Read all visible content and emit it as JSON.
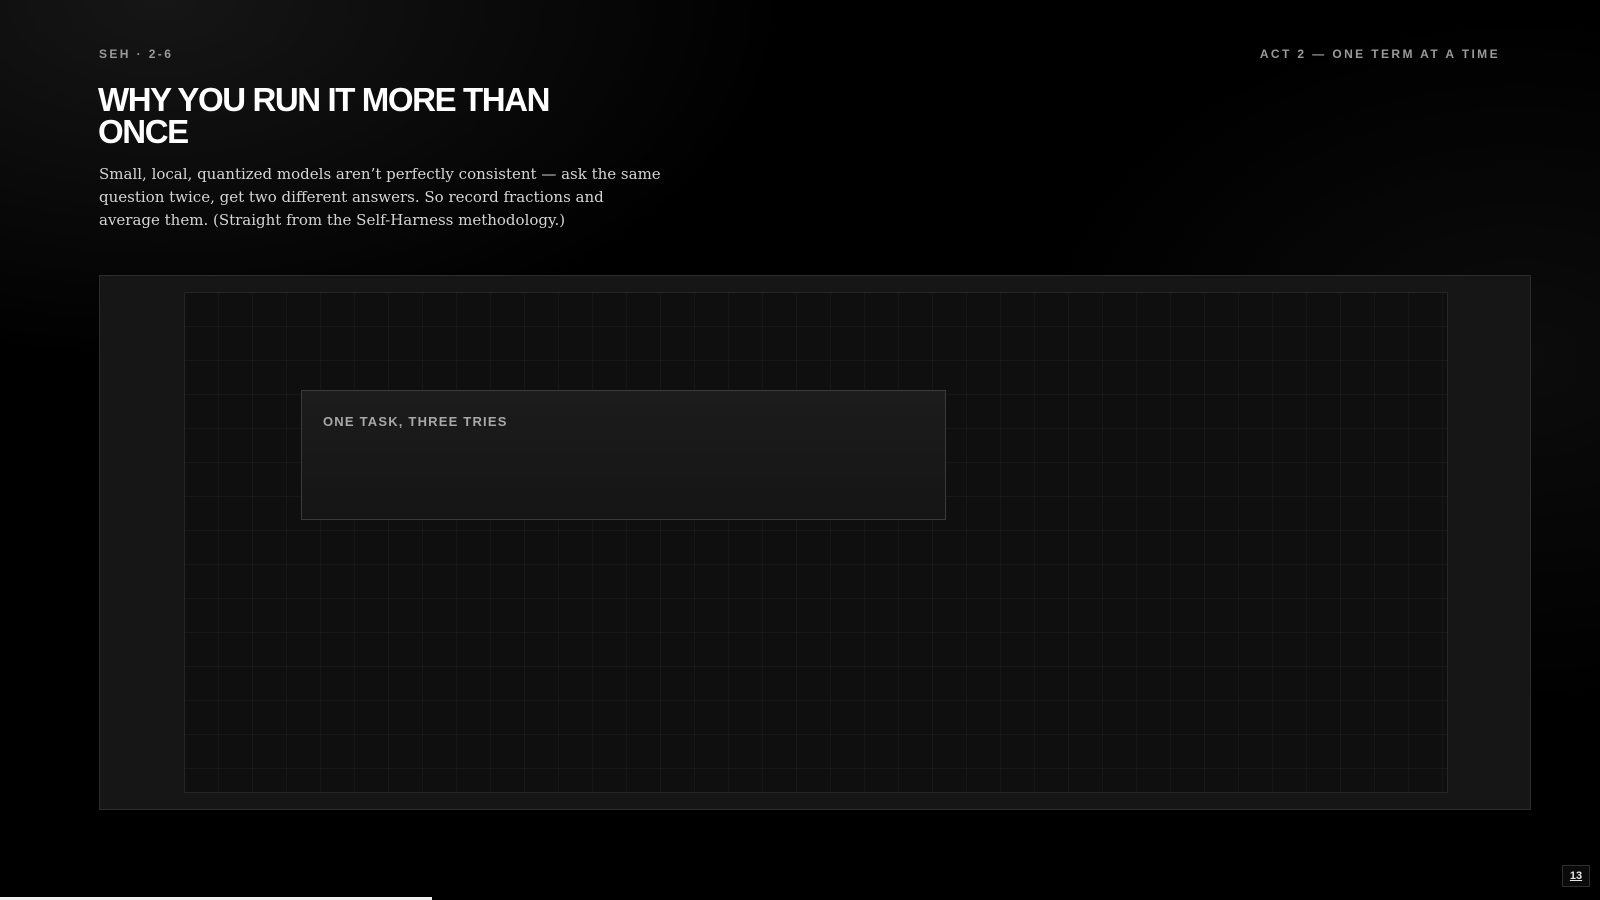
{
  "header": {
    "section_code": "SEH · 2-6",
    "act_label": "ACT 2 — ONE TERM AT A TIME"
  },
  "slide": {
    "title": "WHY YOU RUN IT MORE THAN ONCE",
    "subtitle": "Small, local, quantized models aren’t perfectly consistent — ask the same question twice, get two different answers. So record fractions and average them. (Straight from the Self-Harness methodology.)"
  },
  "card": {
    "label": "ONE TASK, THREE TRIES"
  },
  "footer": {
    "page_number": "13",
    "progress_percent": 27
  },
  "colors": {
    "background": "#000000",
    "panel": "#161616",
    "grid": "#0f0f0f",
    "text": "#ffffff",
    "muted": "#9a9a9a"
  }
}
